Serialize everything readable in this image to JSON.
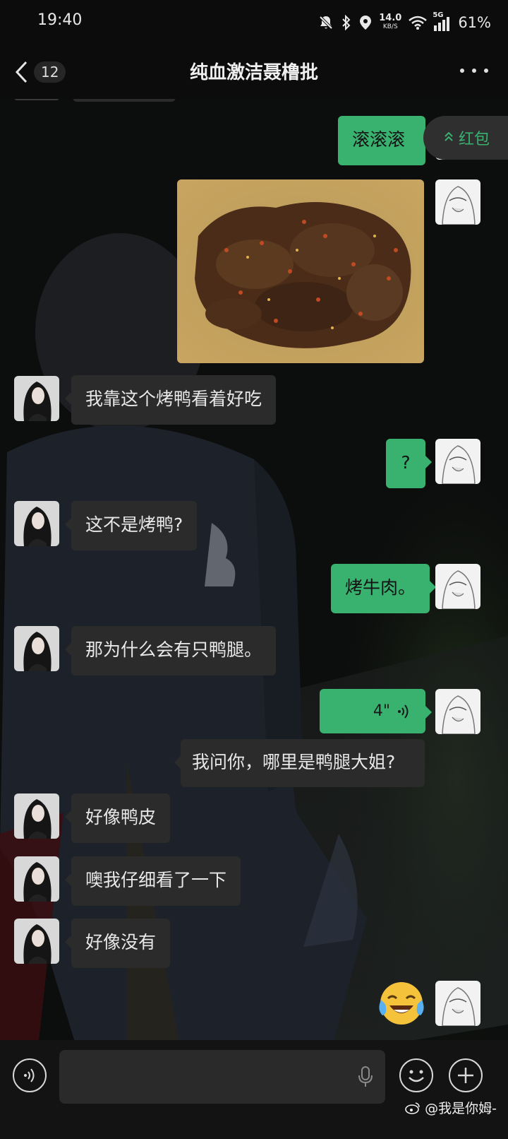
{
  "status_bar": {
    "time": "19:40",
    "net_speed_value": "14.0",
    "net_speed_unit": "KB/S",
    "network": "5G",
    "battery": "61%",
    "icons": [
      "mute-icon",
      "bluetooth-icon",
      "location-icon",
      "wifi-icon",
      "signal-icon"
    ]
  },
  "nav": {
    "unread_count": "12",
    "title": "纯血激洁聂橹批",
    "icons": [
      "chevron-left-icon",
      "more-icon"
    ]
  },
  "red_packet": {
    "label": "红包",
    "icon": "double-chevron-up-icon"
  },
  "messages": [
    {
      "side": "out",
      "type": "text",
      "text": "滚滚滚"
    },
    {
      "side": "out",
      "type": "image",
      "description_icon": "food-photo"
    },
    {
      "side": "in",
      "type": "text",
      "text": "我靠这个烤鸭看着好吃"
    },
    {
      "side": "out",
      "type": "text",
      "text": "?"
    },
    {
      "side": "in",
      "type": "text",
      "text": "这不是烤鸭?"
    },
    {
      "side": "out",
      "type": "text",
      "text": "烤牛肉。"
    },
    {
      "side": "in",
      "type": "text",
      "text": "那为什么会有只鸭腿。"
    },
    {
      "side": "out",
      "type": "voice",
      "duration": "4\""
    },
    {
      "side": "out",
      "type": "text",
      "text": "我问你，哪里是鸭腿大姐?"
    },
    {
      "side": "in",
      "type": "text",
      "text": "好像鸭皮"
    },
    {
      "side": "in",
      "type": "text",
      "text": "噢我仔细看了一下"
    },
    {
      "side": "in",
      "type": "text",
      "text": "好像没有"
    },
    {
      "side": "out",
      "type": "emoji",
      "emoji": "😂"
    }
  ],
  "input_bar": {
    "value": "",
    "icons": [
      "voice-mode-icon",
      "microphone-icon",
      "emoji-icon",
      "plus-icon"
    ]
  },
  "watermark": {
    "text": "@我是你姆-",
    "icon": "weibo-icon"
  },
  "colors": {
    "outgoing_bubble": "#39b26f",
    "incoming_bubble": "#2b2b2b",
    "accent": "#39b26f"
  }
}
